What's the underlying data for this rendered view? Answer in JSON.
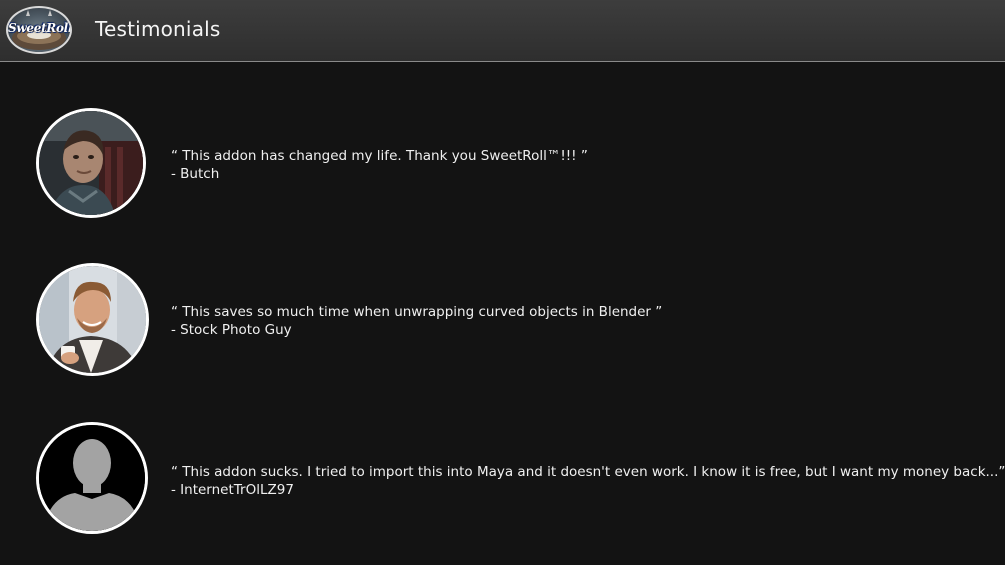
{
  "header": {
    "logo_text": "SweetRoll",
    "title": "Testimonials"
  },
  "testimonials": [
    {
      "quote": "“ This addon has changed my life. Thank you SweetRoll™!!! ”",
      "author": "- Butch",
      "avatar_icon": "boy-portrait-photo"
    },
    {
      "quote": "“ This saves so much time when unwrapping curved objects in Blender ”",
      "author": "- Stock Photo Guy",
      "avatar_icon": "smiling-man-portrait-photo"
    },
    {
      "quote": "“ This addon sucks. I tried to import this into Maya and it doesn't even work. I know it is free, but I want my money back...”",
      "author": "- InternetTrOlLZ97",
      "avatar_icon": "default-user-silhouette-icon"
    }
  ],
  "colors": {
    "background": "#131313",
    "header": "#353535",
    "text": "#f0f0f0",
    "avatar_border": "#ffffff"
  }
}
